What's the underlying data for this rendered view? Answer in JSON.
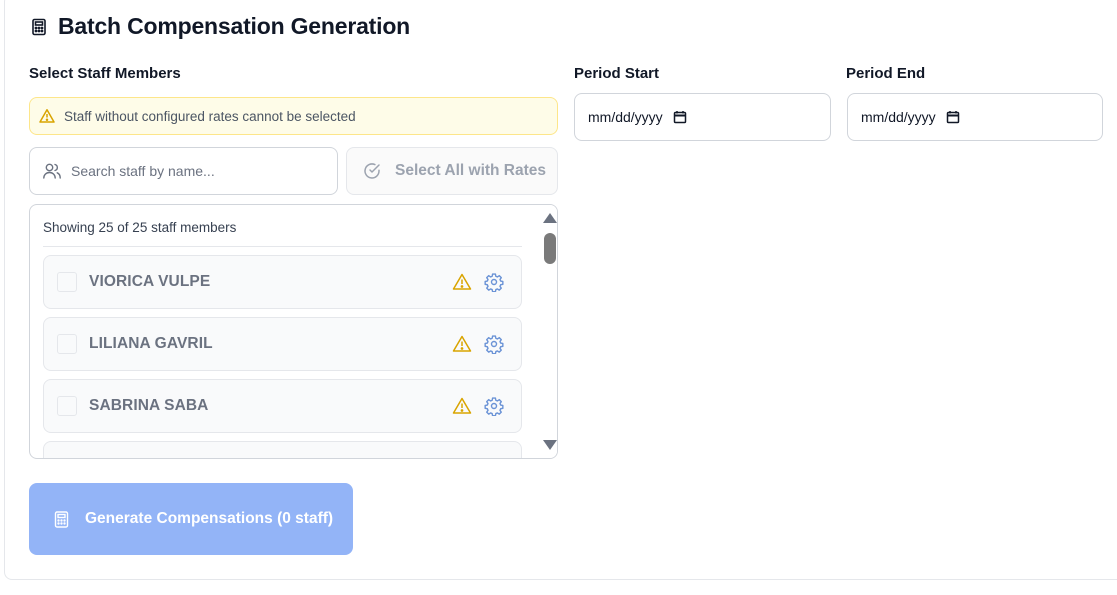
{
  "header": {
    "title": "Batch Compensation Generation",
    "icon": "calculator-icon"
  },
  "staff_section": {
    "label": "Select Staff Members",
    "warning_text": "Staff without configured rates cannot be selected",
    "search_placeholder": "Search staff by name...",
    "select_all_label": "Select All with Rates",
    "showing_text": "Showing 25 of 25 staff members",
    "staff": [
      {
        "name": "VIORICA VULPE",
        "checked": false,
        "rate_configured": false
      },
      {
        "name": "LILIANA GAVRIL",
        "checked": false,
        "rate_configured": false
      },
      {
        "name": "SABRINA SABA",
        "checked": false,
        "rate_configured": false
      }
    ]
  },
  "period": {
    "start_label": "Period Start",
    "start_value": "mm/dd/yyyy",
    "end_label": "Period End",
    "end_value": "mm/dd/yyyy"
  },
  "actions": {
    "generate_label": "Generate Compensations (0 staff)"
  },
  "colors": {
    "warning_bg": "#fefce8",
    "warning_border": "#fde68a",
    "warning_icon": "#d9a400",
    "gear_icon": "#6b93d6",
    "generate_bg": "#93b4f7"
  }
}
